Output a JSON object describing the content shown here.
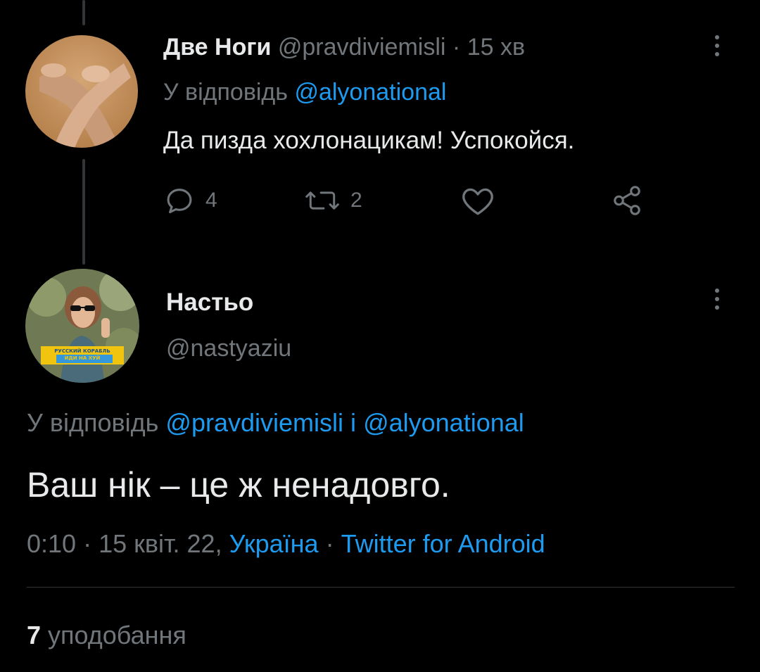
{
  "reply_tweet": {
    "display_name": "Две Ноги",
    "handle": "@pravdiviemisli",
    "separator": "·",
    "time_ago": "15 хв",
    "reply_prefix": "У відповідь",
    "reply_to": "@alyonational",
    "text": "Да пизда хохлонацикам! Успокойся.",
    "reply_count": "4",
    "retweet_count": "2",
    "icons": {
      "more": "more-vertical-icon",
      "reply": "reply-bubble-icon",
      "retweet": "retweet-icon",
      "like": "heart-icon",
      "share": "share-icon"
    }
  },
  "main_tweet": {
    "display_name": "Настьо",
    "handle": "@nastyaziu",
    "reply_prefix": "У відповідь",
    "reply_to_1": "@pravdiviemisli",
    "reply_joiner": "і",
    "reply_to_2": "@alyonational",
    "text": "Ваш нік – це ж ненадовго.",
    "time": "0:10",
    "date": "15 квіт. 22,",
    "location": "Україна",
    "source": "Twitter for Android",
    "separator": "·",
    "avatar_badge_line1": "РУССКИЙ КОРАБЛЬ",
    "avatar_badge_line2": "ИДИ НА ХУЙ"
  },
  "stats": {
    "likes_count": "7",
    "likes_label": "уподобання"
  },
  "colors": {
    "background": "#000000",
    "text": "#e7e9ea",
    "muted": "#71767b",
    "link": "#1d9bf0",
    "divider": "#2f3336"
  }
}
